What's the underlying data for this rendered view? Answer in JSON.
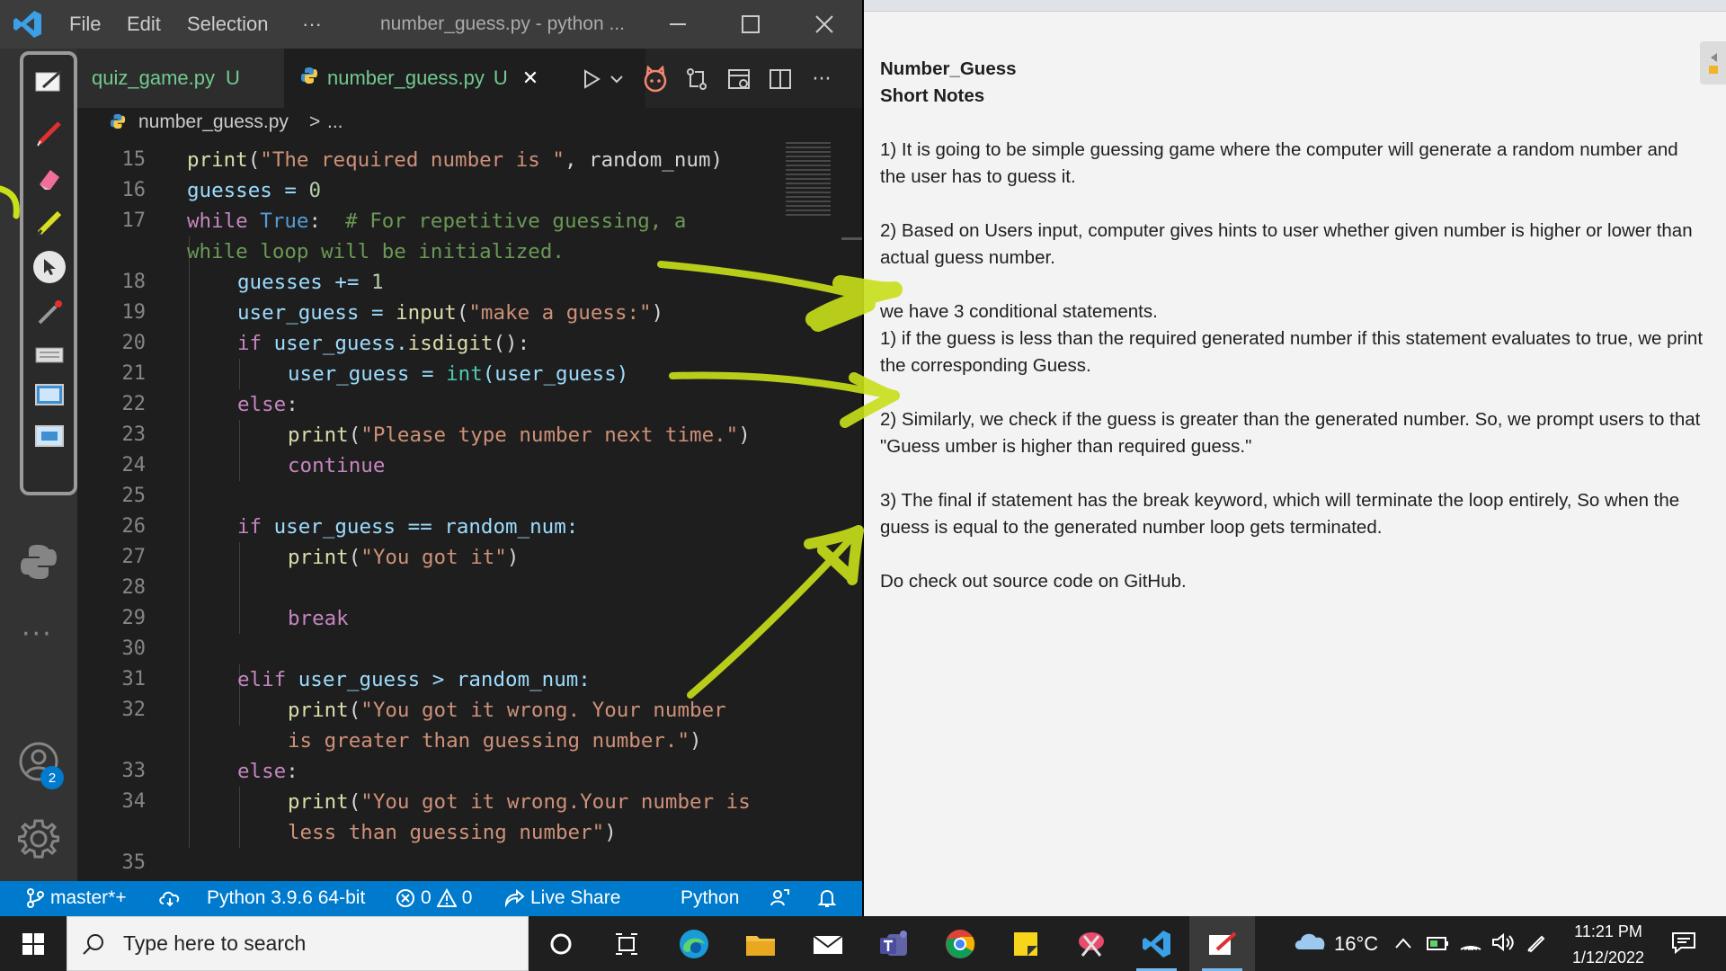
{
  "window": {
    "title": "number_guess.py - python ...",
    "menu": [
      "File",
      "Edit",
      "Selection",
      "···"
    ]
  },
  "tabs": [
    {
      "label": "quiz_game.py",
      "status": "U"
    },
    {
      "label": "number_guess.py",
      "status": "U",
      "close": "✕"
    }
  ],
  "breadcrumb": {
    "file": "number_guess.py",
    "sep": ">",
    "rest": "..."
  },
  "editor": {
    "line_numbers": [
      "15",
      "16",
      "17",
      "18",
      "19",
      "20",
      "21",
      "22",
      "23",
      "24",
      "25",
      "26",
      "27",
      "28",
      "29",
      "30",
      "31",
      "32",
      "33",
      "34",
      "35"
    ],
    "code": {
      "l15": {
        "fn": "print",
        "open": "(",
        "str": "\"The required number is \"",
        "rest": ", random_num)"
      },
      "l16": {
        "text": "guesses = ",
        "num": "0"
      },
      "l17": {
        "kw": "while",
        "bi": "True",
        "colon": ":",
        "comment": "# For repetitive guessing, a",
        "comment2": "while loop will be initialized."
      },
      "l18": {
        "text": "guesses += ",
        "num": "1"
      },
      "l19": {
        "var": "user_guess = ",
        "fn": "input",
        "str": "\"make a guess:\"",
        "close": ")"
      },
      "l20": {
        "kw": "if",
        "rest": " user_guess.",
        "fn": "isdigit",
        "close": "():"
      },
      "l21": {
        "var": "user_guess = ",
        "bi": "int",
        "rest": "(user_guess)"
      },
      "l22": {
        "kw": "else",
        "colon": ":"
      },
      "l23": {
        "fn": "print",
        "str": "\"Please type number next time.\"",
        "close": ")"
      },
      "l24": {
        "kw": "continue"
      },
      "l26": {
        "kw": "if",
        "rest": " user_guess == random_num:"
      },
      "l27": {
        "fn": "print",
        "str": "\"You got it\"",
        "close": ")"
      },
      "l29": {
        "kw": "break"
      },
      "l31": {
        "kw": "elif",
        "rest": " user_guess > random_num:"
      },
      "l32": {
        "fn": "print",
        "str": "\"You got it wrong. Your number",
        "str2": "is greater than guessing number.\"",
        "close": ")"
      },
      "l33": {
        "kw": "else",
        "colon": ":"
      },
      "l34": {
        "fn": "print",
        "str": "\"You got it wrong.Your number is",
        "str2": "less than guessing number\"",
        "close": ")"
      }
    }
  },
  "activity": {
    "badge": "2"
  },
  "statusbar": {
    "branch": "master*+",
    "interpreter": "Python 3.9.6 64-bit",
    "errors": "0",
    "warnings": "0",
    "live_share": "Live Share",
    "language": "Python"
  },
  "notes": {
    "title": "Number_Guess",
    "subtitle": "Short Notes",
    "p1": "1) It is going to be simple guessing game where the computer will generate a random number and the user has to guess it.",
    "p2": "2) Based on Users input, computer gives hints to user whether given number is higher or lower than actual guess number.",
    "p3a": "we have 3 conditional statements.",
    "p3b": "1) if the guess is less than the required generated  number if this statement evaluates to true, we print the corresponding Guess.",
    "p4": "2) Similarly, we check if the guess is greater than the generated number. So, we prompt users to that \"Guess umber is higher than required guess.\"",
    "p5": "3) The final if statement has the break keyword, which will terminate the loop entirely, So when the guess is equal to the generated number loop gets terminated.",
    "p6": "Do check out source code on GitHub."
  },
  "taskbar": {
    "search_placeholder": "Type here to search",
    "temperature": "16°C",
    "time": "11:21 PM",
    "date": "1/12/2022"
  },
  "colors": {
    "accent": "#007acc",
    "highlighter": "#c8e01a",
    "untracked": "#73c991"
  }
}
